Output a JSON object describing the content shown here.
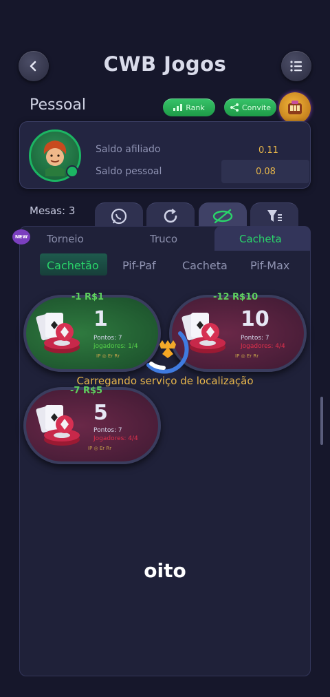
{
  "header": {
    "title": "CWB Jogos",
    "back_icon": "back-arrow-icon",
    "menu_icon": "menu-icon"
  },
  "section": {
    "title": "Pessoal",
    "rank_label": "Rank",
    "invite_label": "Convite"
  },
  "profile": {
    "affiliate_label": "Saldo afiliado",
    "affiliate_value": "0.11",
    "personal_label": "Saldo pessoal",
    "personal_value": "0.08"
  },
  "toolbar": {
    "tables_label": "Mesas: 3"
  },
  "tabs": {
    "new_badge": "NEW",
    "items": [
      "Torneio",
      "Truco",
      "Cacheta"
    ],
    "active": "Cacheta"
  },
  "subtabs": {
    "items": [
      "Cachetão",
      "Pif-Paf",
      "Cacheta",
      "Pif-Max"
    ],
    "active": "Cachetão"
  },
  "tables": [
    {
      "stake": "-1 R$1",
      "number": "1",
      "points": "Pontos: 7",
      "players": "jogadores: 1/4",
      "tags": "IP ◎ Er Rr",
      "color": "green"
    },
    {
      "stake": "-12 R$10",
      "number": "10",
      "points": "Pontos: 7",
      "players": "Jogadores: 4/4",
      "tags": "IP ◎ Er Rr",
      "color": "red"
    },
    {
      "stake": "-7 R$5",
      "number": "5",
      "points": "Pontos: 7",
      "players": "Jogadores: 4/4",
      "tags": "IP ◎ Er Rr",
      "color": "red"
    }
  ],
  "loading_text": "Carregando serviço de localização",
  "caption": "oito",
  "colors": {
    "accent_green": "#1cb563",
    "gold": "#e6b54b",
    "background": "#16172b"
  }
}
